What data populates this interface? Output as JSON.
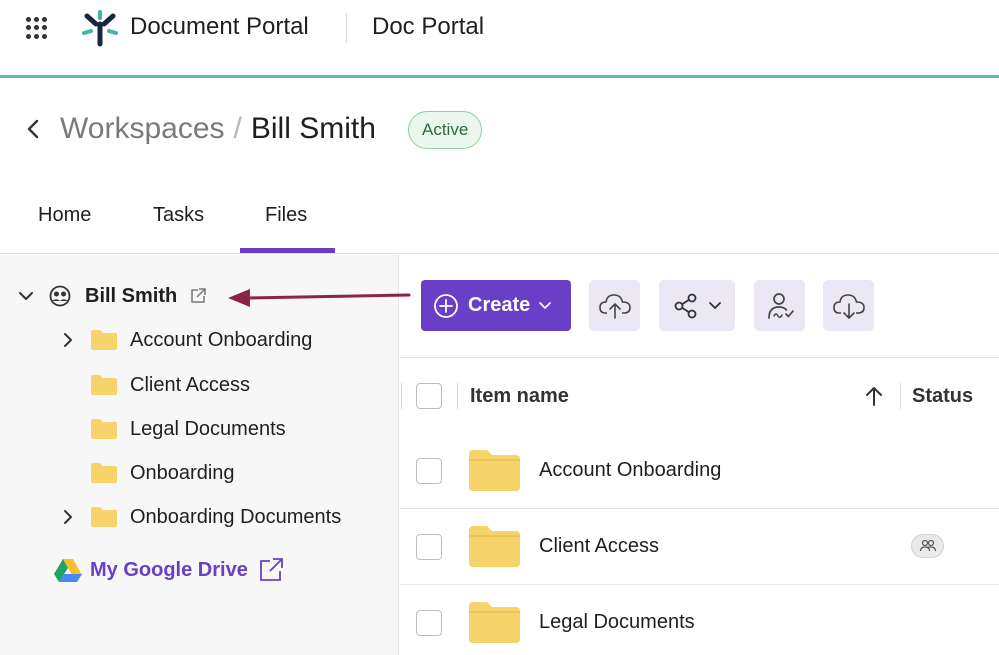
{
  "header": {
    "app_name": "Document Portal",
    "portal_name": "Doc Portal"
  },
  "breadcrumb": {
    "parent": "Workspaces",
    "separator": "/",
    "current": "Bill Smith",
    "status": "Active"
  },
  "tabs": [
    {
      "label": "Home"
    },
    {
      "label": "Tasks"
    },
    {
      "label": "Files",
      "active": true
    }
  ],
  "tree": {
    "root_label": "Bill Smith",
    "items": [
      {
        "label": "Account Onboarding",
        "expandable": true
      },
      {
        "label": "Client Access",
        "expandable": false
      },
      {
        "label": "Legal Documents",
        "expandable": false
      },
      {
        "label": "Onboarding",
        "expandable": false
      },
      {
        "label": "Onboarding Documents",
        "expandable": true
      }
    ],
    "google_drive_label": "My Google Drive"
  },
  "toolbar": {
    "create_label": "Create"
  },
  "table": {
    "columns": {
      "name": "Item name",
      "status": "Status"
    },
    "rows": [
      {
        "name": "Account Onboarding",
        "shared": false
      },
      {
        "name": "Client Access",
        "shared": true
      },
      {
        "name": "Legal Documents",
        "shared": false
      }
    ]
  },
  "colors": {
    "accent": "#6a3fc7",
    "header_rule": "#5fb8ae",
    "folder": "#f7d46b",
    "annotation_arrow": "#8c2446",
    "active_badge_bg": "#e9f7ec"
  }
}
